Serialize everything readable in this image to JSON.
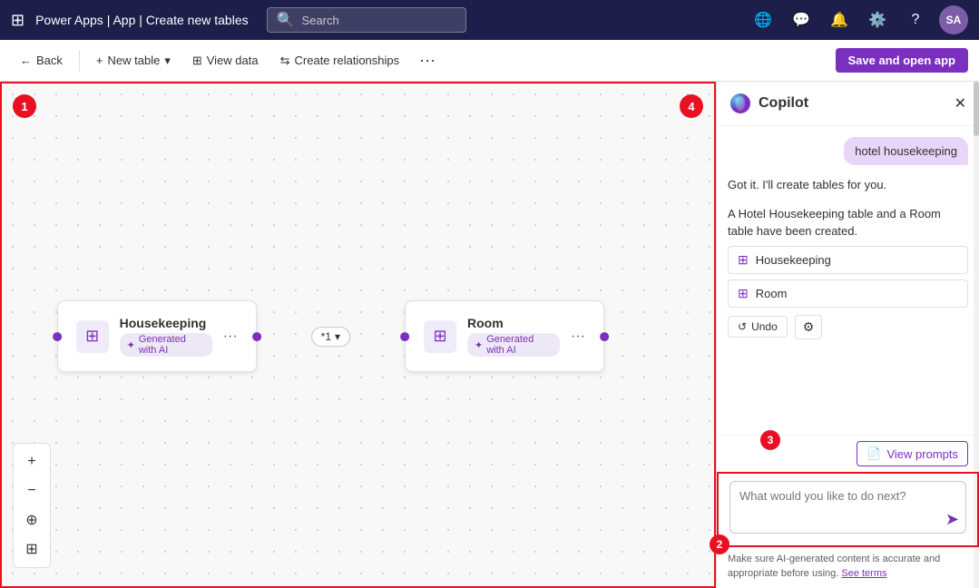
{
  "nav": {
    "grid_icon": "⊞",
    "title": "Power Apps | App | Create new tables",
    "search_placeholder": "Search",
    "icons": [
      "🌐",
      "💬",
      "🔔",
      "⚙️",
      "?"
    ],
    "avatar": "SA"
  },
  "toolbar": {
    "back_label": "Back",
    "new_table_label": "New table",
    "view_data_label": "View data",
    "create_relationships_label": "Create relationships",
    "save_label": "Save and open app"
  },
  "canvas": {
    "badge_1": "1",
    "badge_4": "4",
    "tools": [
      "+",
      "−",
      "⊕",
      "⊞"
    ],
    "cards": [
      {
        "name": "Housekeeping",
        "ai_label": "Generated with AI"
      },
      {
        "name": "Room",
        "ai_label": "Generated with AI"
      }
    ],
    "connector_label": "*1",
    "connector_symbol": "↕"
  },
  "copilot": {
    "title": "Copilot",
    "close_icon": "✕",
    "messages": [
      {
        "type": "user",
        "text": "hotel housekeeping"
      },
      {
        "type": "bot_plain",
        "text": "Got it. I'll create tables for you."
      },
      {
        "type": "bot_block",
        "text": "A Hotel Housekeeping table and a Room table have been created.",
        "chips": [
          "Housekeeping",
          "Room"
        ]
      }
    ],
    "undo_label": "Undo",
    "view_prompts_label": "View prompts",
    "badge_2": "2",
    "badge_3": "3",
    "input_placeholder": "What would you like to do next?",
    "send_icon": "➤",
    "footer_text": "Make sure AI-generated content is accurate and appropriate before using.",
    "footer_link": "See terms"
  }
}
